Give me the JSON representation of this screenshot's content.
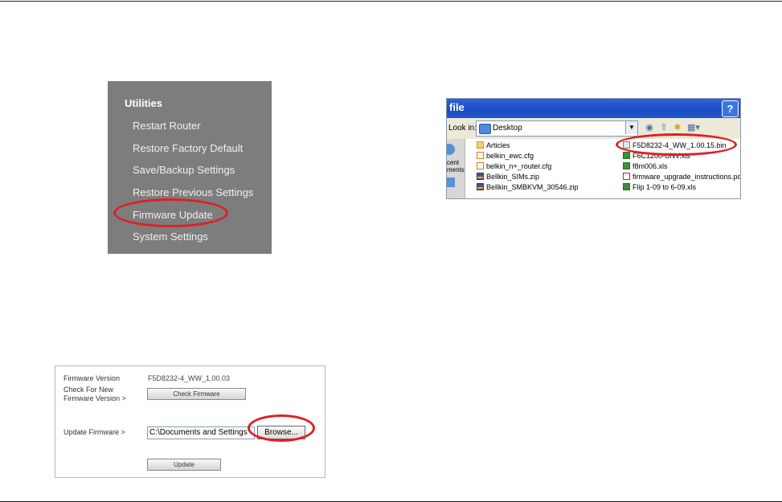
{
  "utilities": {
    "title": "Utilities",
    "items": [
      {
        "label": "Restart Router"
      },
      {
        "label": "Restore Factory Default"
      },
      {
        "label": "Save/Backup Settings"
      },
      {
        "label": "Restore Previous Settings"
      },
      {
        "label": "Firmware Update"
      },
      {
        "label": "System Settings"
      }
    ]
  },
  "file_dialog": {
    "title": "file",
    "help": "?",
    "look_in_label": "Look in:",
    "look_in_value": "Desktop",
    "places_text": "cent\nments",
    "files_left": [
      {
        "name": "Articles",
        "icon": "folder-icon"
      },
      {
        "name": "belkin_ewc.cfg",
        "icon": "cfg-file-icon"
      },
      {
        "name": "belkin_n+_router.cfg",
        "icon": "cfg-file-icon"
      },
      {
        "name": "Bellkin_SIMs.zip",
        "icon": "zip-file-icon"
      },
      {
        "name": "Bellkin_SMBKVM_30546.zip",
        "icon": "zip-file-icon"
      }
    ],
    "files_right": [
      {
        "name": "F5D8232-4_WW_1.00.15.bin",
        "icon": "bin-file-icon"
      },
      {
        "name": "F6C1200-UNV.xls",
        "icon": "xls-file-icon"
      },
      {
        "name": "f8m006.xls",
        "icon": "xls-file-icon"
      },
      {
        "name": "firmware_upgrade_instructions.pdf",
        "icon": "pdf-file-icon"
      },
      {
        "name": "Flip 1-09 to 6-09.xls",
        "icon": "xls-file-icon"
      }
    ]
  },
  "firmware": {
    "version_label": "Firmware Version",
    "version_value": "F5D8232-4_WW_1.00.03",
    "check_label_line1": "Check For New",
    "check_label_line2": "Firmware Version >",
    "check_button": "Check Firmware",
    "update_label": "Update Firmware >",
    "path_value": "C:\\Documents and Settings",
    "browse_button": "Browse...",
    "update_button": "Update"
  },
  "colors": {
    "highlight_ring": "#e01e25",
    "menu_bg": "#7d7d7d"
  }
}
